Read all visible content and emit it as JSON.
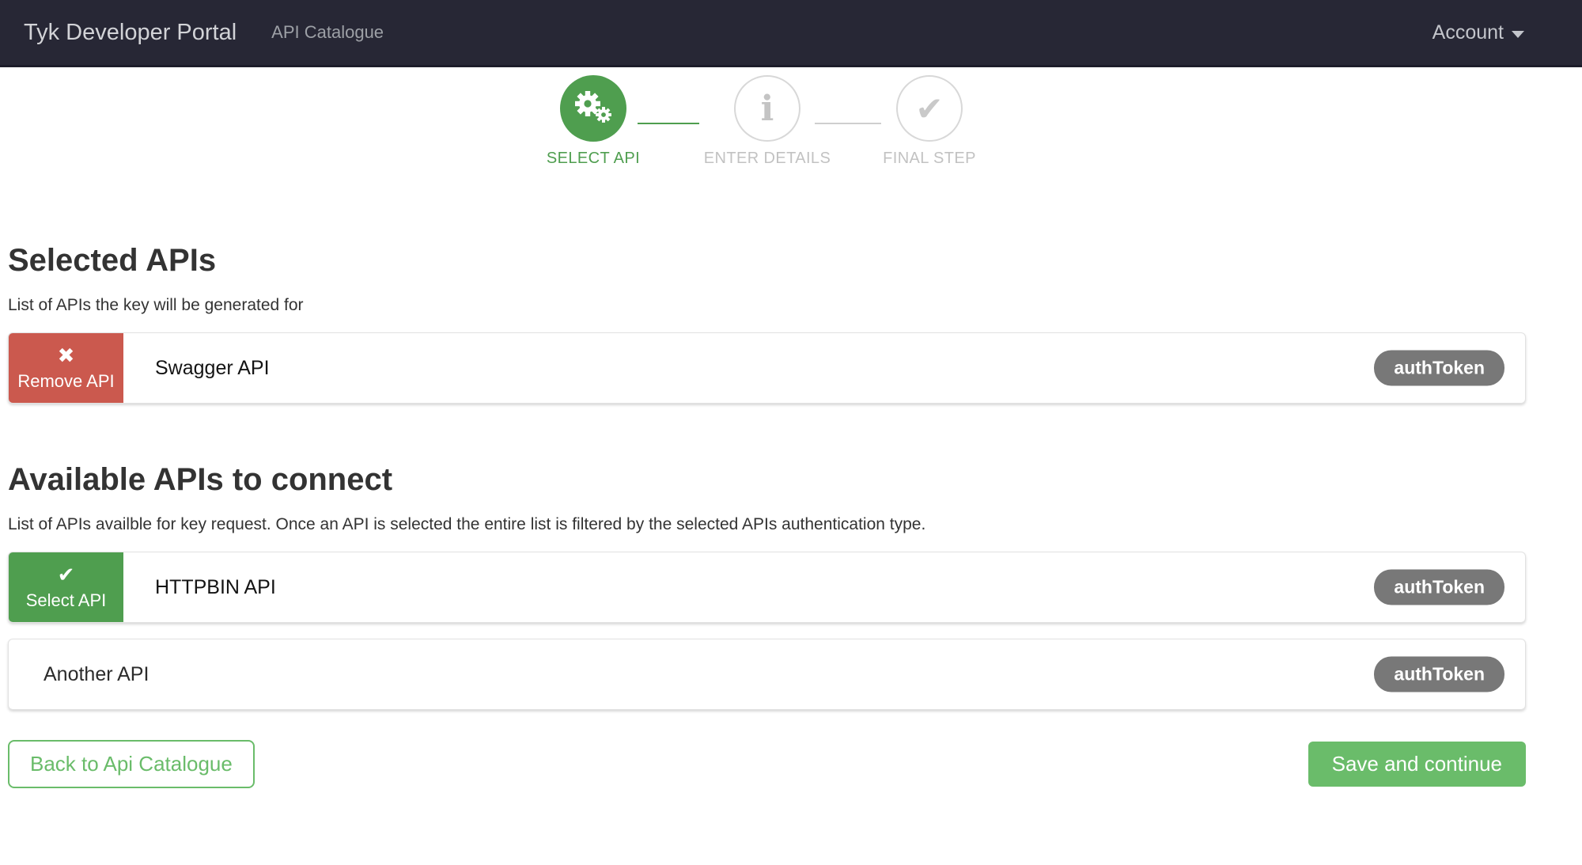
{
  "navbar": {
    "brand": "Tyk Developer Portal",
    "catalogue_link": "API Catalogue",
    "account_label": "Account"
  },
  "stepper": {
    "steps": [
      {
        "label": "SELECT API",
        "icon": "cogs-icon",
        "active": true
      },
      {
        "label": "ENTER DETAILS",
        "icon": "info-icon",
        "glyph": "i",
        "active": false
      },
      {
        "label": "FINAL STEP",
        "icon": "check-icon",
        "glyph": "✔",
        "active": false
      }
    ]
  },
  "selected_apis": {
    "heading": "Selected APIs",
    "subheading": "List of APIs the key will be generated for",
    "items": [
      {
        "name": "Swagger API",
        "auth_type": "authToken",
        "action": {
          "label": "Remove API",
          "icon": "x-icon",
          "glyph": "✖"
        }
      }
    ]
  },
  "available_apis": {
    "heading": "Available APIs to connect",
    "subheading": "List of APIs availble for key request. Once an API is selected the entire list is filtered by the selected APIs authentication type.",
    "items": [
      {
        "name": "HTTPBIN API",
        "auth_type": "authToken",
        "action": {
          "label": "Select API",
          "icon": "check-icon",
          "glyph": "✔"
        }
      },
      {
        "name": "Another API",
        "auth_type": "authToken"
      }
    ]
  },
  "footer": {
    "back_button": "Back to Api Catalogue",
    "save_button": "Save and continue"
  },
  "colors": {
    "navbar_bg": "#272735",
    "accent_green": "#4f9e4f",
    "button_green": "#6abc6a",
    "danger_red": "#cb594e",
    "badge_gray": "#787878"
  }
}
